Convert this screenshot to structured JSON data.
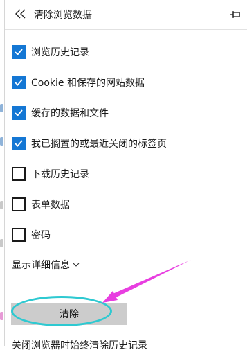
{
  "header": {
    "back_icon": "double-chevron-left-icon",
    "title": "清除浏览数据",
    "pin_icon": "pin-icon"
  },
  "options": [
    {
      "label": "浏览历史记录",
      "checked": true
    },
    {
      "label": "Cookie 和保存的网站数据",
      "checked": true
    },
    {
      "label": "缓存的数据和文件",
      "checked": true
    },
    {
      "label": "我已搁置的或最近关闭的标签页",
      "checked": true
    },
    {
      "label": "下载历史记录",
      "checked": false
    },
    {
      "label": "表单数据",
      "checked": false
    },
    {
      "label": "密码",
      "checked": false
    }
  ],
  "details_link": "显示详细信息",
  "clear_button": "清除",
  "bottom_text": "关闭浏览器时始终清除历史记录",
  "colors": {
    "checkbox_checked": "#1477d4",
    "button_bg": "#cccccc",
    "highlight_ellipse": "#2ec9d1",
    "arrow": "#e83ee0"
  }
}
